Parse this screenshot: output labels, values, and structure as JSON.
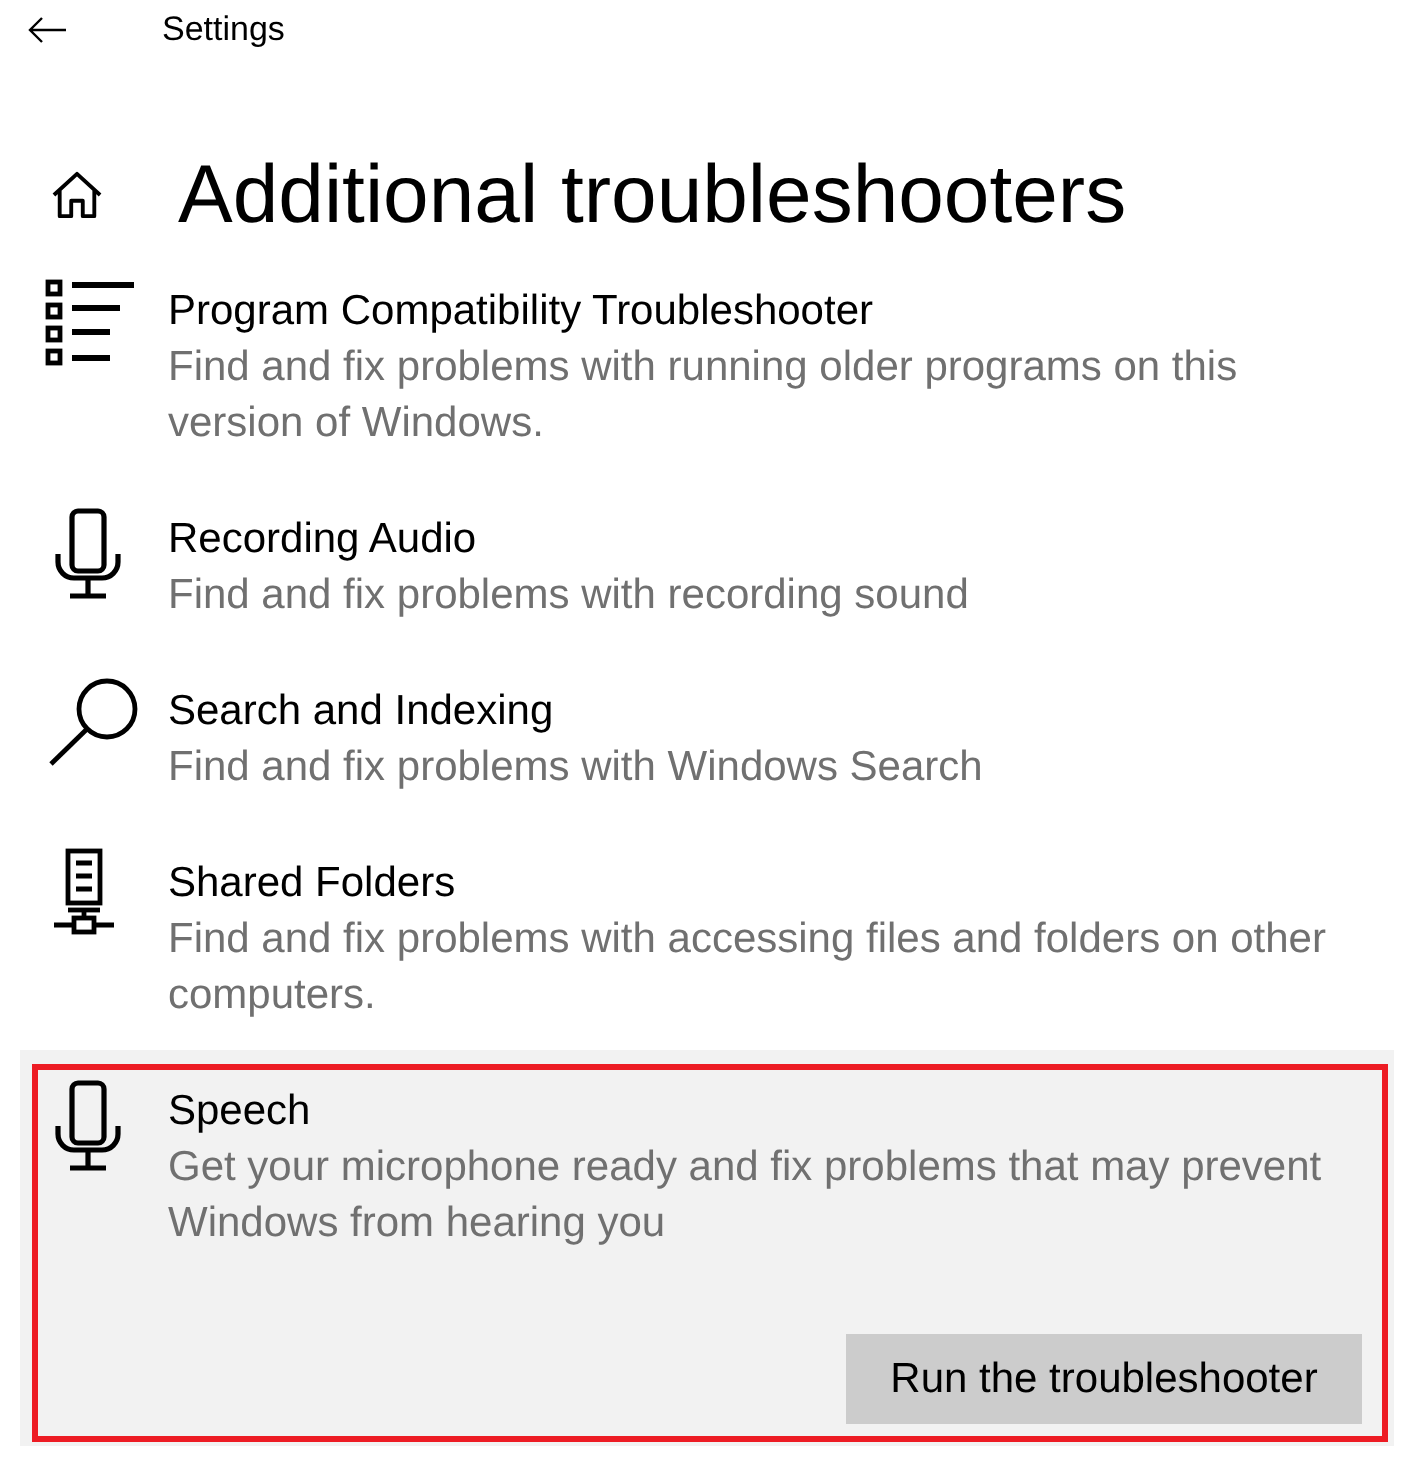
{
  "header": {
    "title": "Settings"
  },
  "page": {
    "title": "Additional troubleshooters"
  },
  "troubleshooters": [
    {
      "title": "Program Compatibility Troubleshooter",
      "description": "Find and fix problems with running older programs on this version of Windows.",
      "expanded": false,
      "highlighted": false
    },
    {
      "title": "Recording Audio",
      "description": "Find and fix problems with recording sound",
      "expanded": false,
      "highlighted": false
    },
    {
      "title": "Search and Indexing",
      "description": "Find and fix problems with Windows Search",
      "expanded": false,
      "highlighted": false
    },
    {
      "title": "Shared Folders",
      "description": "Find and fix problems with accessing files and folders on other computers.",
      "expanded": false,
      "highlighted": false
    },
    {
      "title": "Speech",
      "description": "Get your microphone ready and fix problems that may prevent Windows from hearing you",
      "expanded": true,
      "highlighted": true,
      "button": "Run the troubleshooter"
    }
  ]
}
